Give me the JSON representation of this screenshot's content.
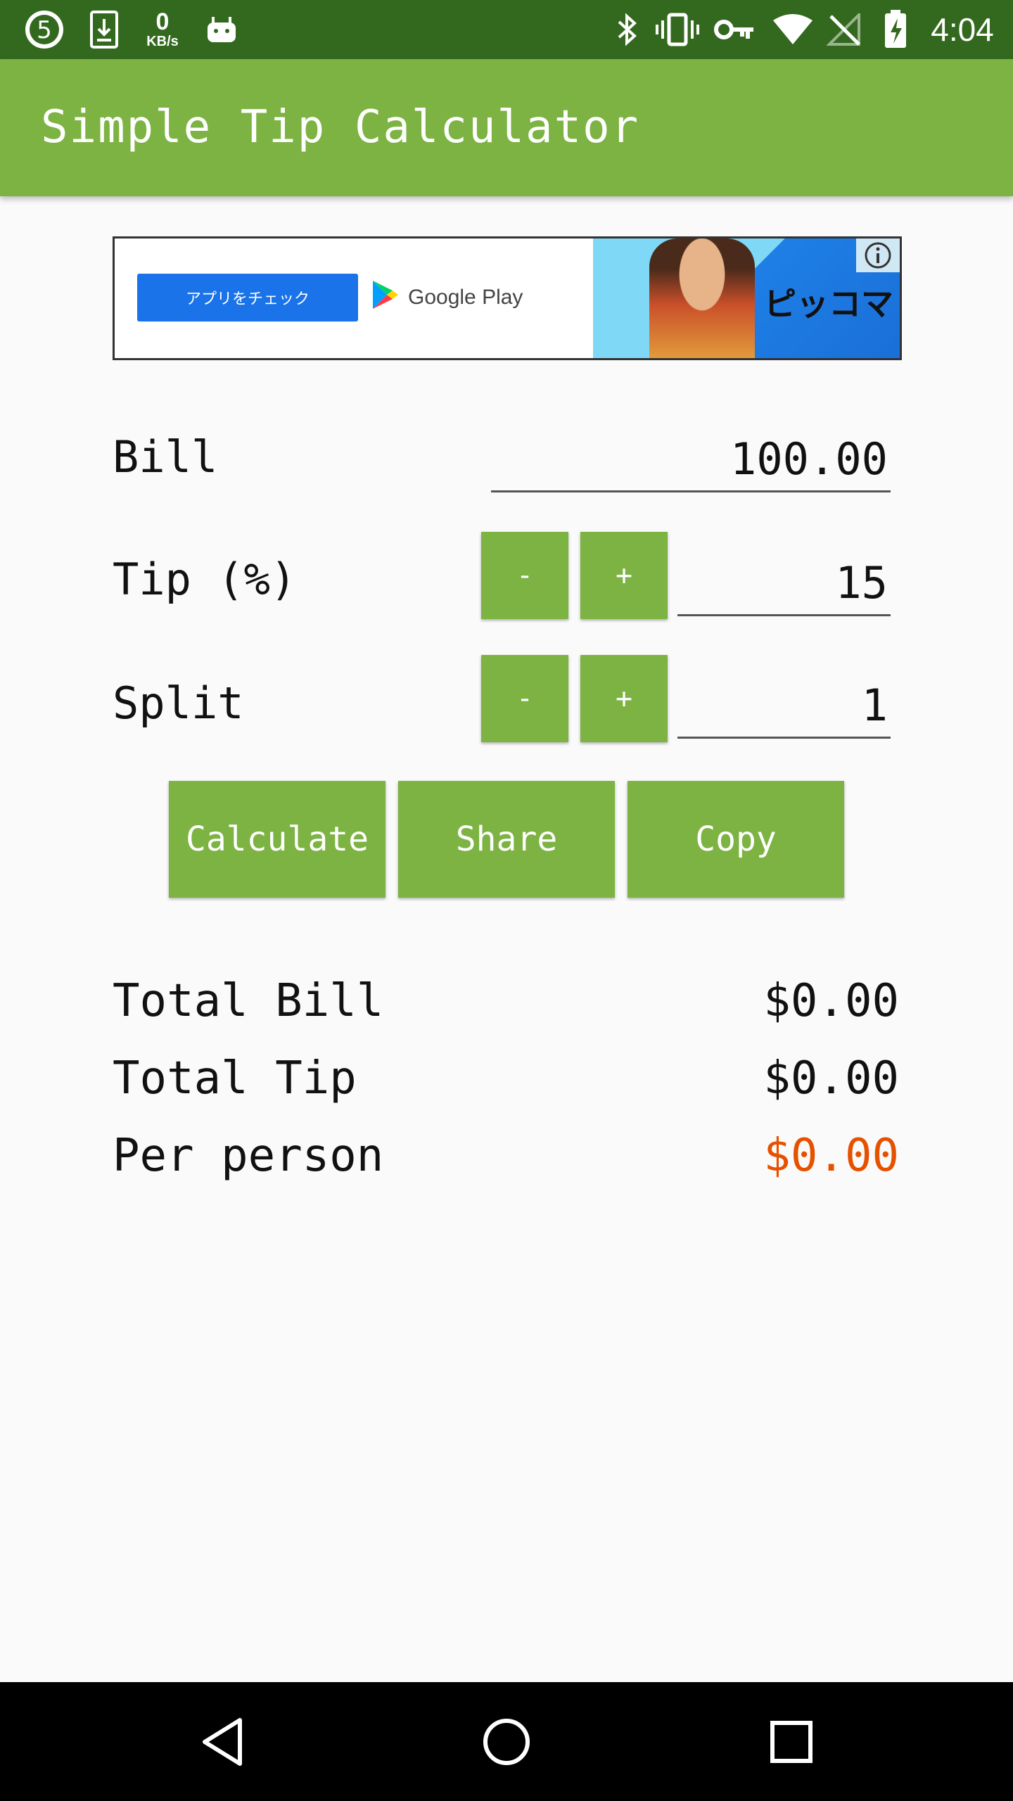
{
  "status_bar": {
    "net_speed_value": "0",
    "net_speed_unit": "KB/s",
    "time": "4:04"
  },
  "app_bar": {
    "title": "Simple Tip Calculator"
  },
  "ad": {
    "cta_label": "アプリをチェック",
    "store_name": "Google Play",
    "brand_logo": "ピッコマ"
  },
  "form": {
    "bill": {
      "label": "Bill",
      "value": "100.00"
    },
    "tip": {
      "label": "Tip (%)",
      "value": "15",
      "minus": "-",
      "plus": "+"
    },
    "split": {
      "label": "Split",
      "value": "1",
      "minus": "-",
      "plus": "+"
    }
  },
  "actions": {
    "calculate": "Calculate",
    "share": "Share",
    "copy": "Copy"
  },
  "results": {
    "total_bill": {
      "label": "Total Bill",
      "value": "$0.00"
    },
    "total_tip": {
      "label": "Total Tip",
      "value": "$0.00"
    },
    "per_person": {
      "label": "Per person",
      "value": "$0.00",
      "color": "#e65100"
    }
  },
  "colors": {
    "primary": "#7cb342",
    "primary_dark": "#33691e",
    "accent": "#e65100"
  }
}
